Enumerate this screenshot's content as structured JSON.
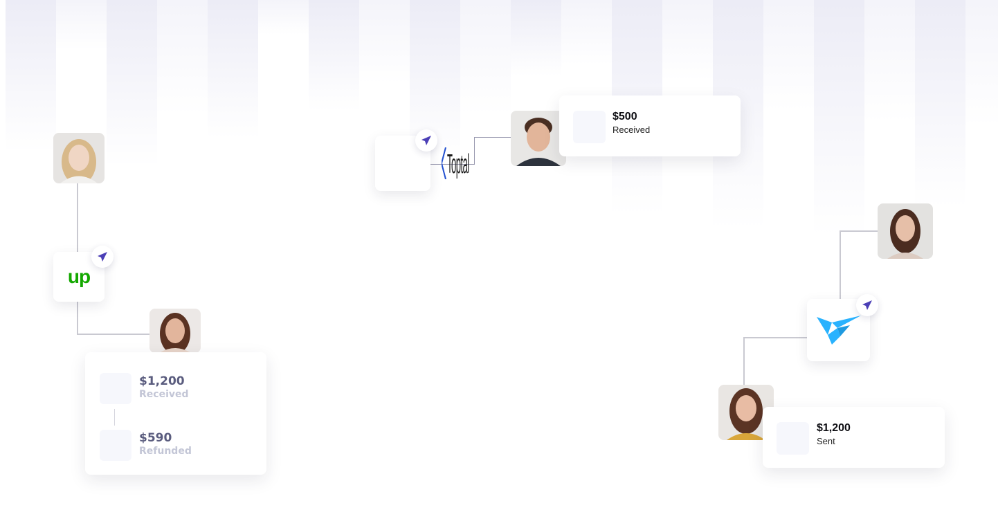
{
  "colors": {
    "stripe": "#ececf6",
    "plane": "#4b3fb6",
    "upwork_green": "#14a800",
    "toptal_blue": "#204ecf",
    "freelancer_blue": "#29b2fe"
  },
  "left_group": {
    "platform_logo_text": "up",
    "transactions": [
      {
        "amount": "$1,200",
        "label": "Received"
      },
      {
        "amount": "$590",
        "label": "Refunded"
      }
    ]
  },
  "center_group": {
    "platform_logo_text": "Toptal",
    "amount": "$500",
    "label": "Received"
  },
  "right_group": {
    "platform_logo": "freelancer-bird",
    "amount": "$1,200",
    "label": "Sent"
  },
  "icons": [
    "paper-plane-icon",
    "upwork-logo",
    "toptal-logo",
    "freelancer-logo"
  ]
}
